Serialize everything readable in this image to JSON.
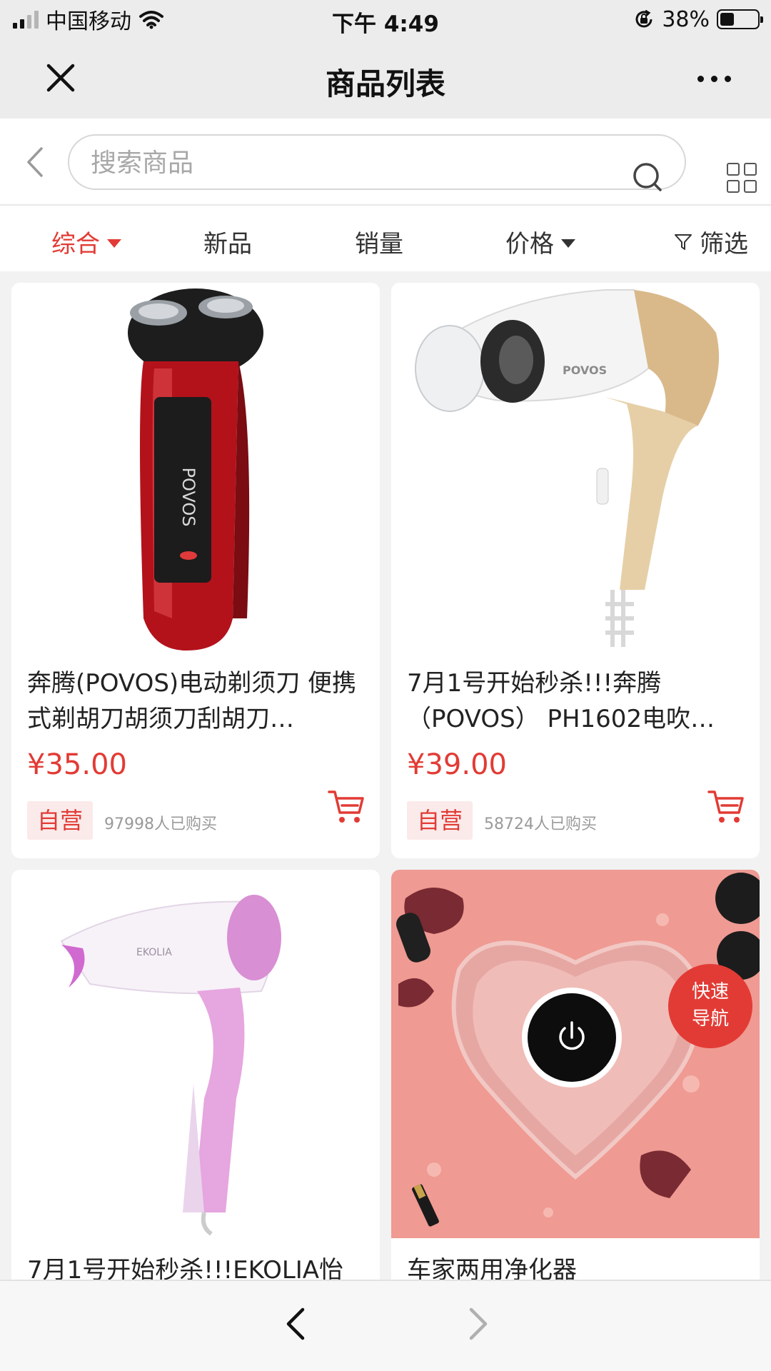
{
  "status_bar": {
    "carrier": "中国移动",
    "time": "下午 4:49",
    "battery": "38%",
    "battery_level": 0.38,
    "icons": [
      "signal-icon",
      "wifi-icon",
      "orientation-lock-icon",
      "battery-icon"
    ]
  },
  "title_bar": {
    "title": "商品列表",
    "icons": [
      "close-icon",
      "more-icon"
    ]
  },
  "search": {
    "placeholder": "搜索商品",
    "value": "",
    "icons": [
      "back-icon",
      "search-icon",
      "grid-view-icon"
    ]
  },
  "filters": [
    {
      "label": "综合",
      "active": true,
      "has_arrow": true
    },
    {
      "label": "新品",
      "active": false,
      "has_arrow": false
    },
    {
      "label": "销量",
      "active": false,
      "has_arrow": false
    },
    {
      "label": "价格",
      "active": false,
      "has_arrow": true
    },
    {
      "label": "筛选",
      "active": false,
      "icon": "filter-funnel-icon"
    }
  ],
  "colors": {
    "accent": "#e23b35",
    "tag_bg": "#fbeaea",
    "page_bg": "#f2f2f2",
    "header_bg": "#ececec"
  },
  "products": [
    {
      "name": "奔腾(POVOS)电动剃须刀 便携式剃胡刀胡须刀刮胡刀…",
      "price": "¥35.00",
      "tag": "自营",
      "sold": "97998人已购买",
      "image": "electric-shaver-red",
      "image_text": "POVOS"
    },
    {
      "name": "7月1号开始秒杀!!!奔腾（POVOS） PH1602电吹…",
      "price": "¥39.00",
      "tag": "自营",
      "sold": "58724人已购买",
      "image": "hair-dryer-white-gold",
      "image_text": "POVOS"
    },
    {
      "name": "7月1号开始秒杀!!!EKOLIA怡",
      "image": "hair-dryer-pink",
      "image_text": "EKOLIA"
    },
    {
      "name": "车家两用净化器",
      "image": "heart-air-purifier-pink"
    }
  ],
  "quick_nav": {
    "line1": "快速",
    "line2": "导航"
  },
  "bottom_bar": {
    "icons": [
      "nav-back-icon",
      "nav-forward-icon"
    ]
  }
}
